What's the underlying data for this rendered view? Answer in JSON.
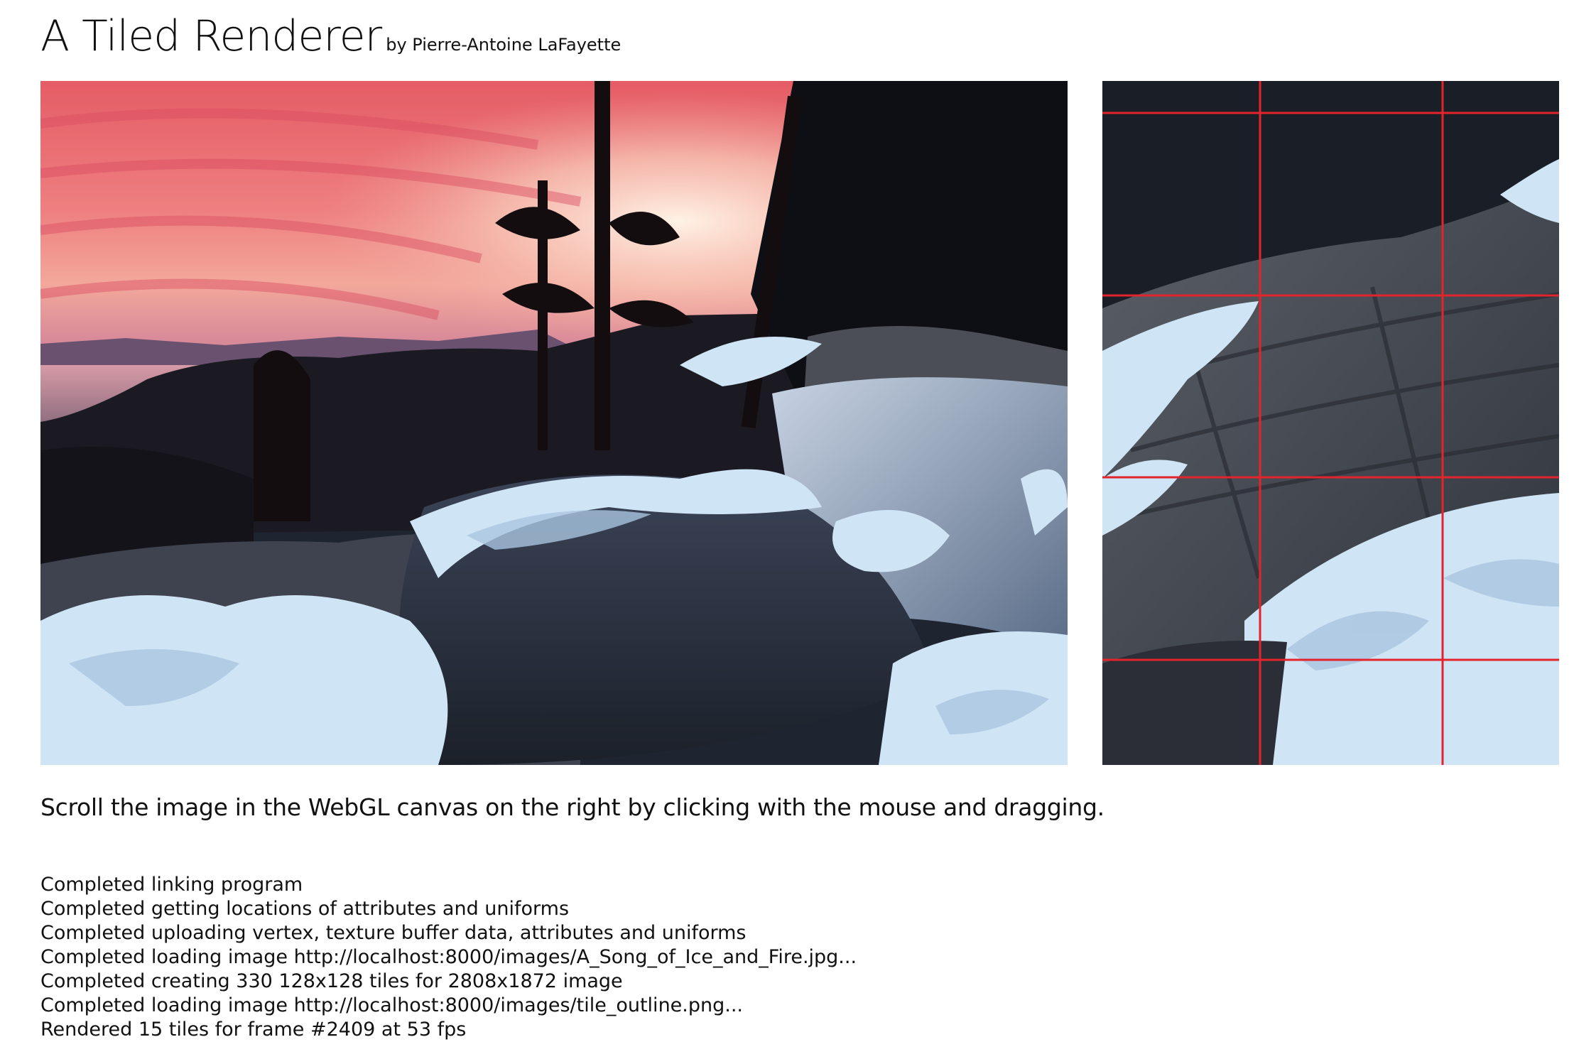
{
  "header": {
    "title": "A Tiled Renderer",
    "byline": "by Pierre-Antoine LaFayette"
  },
  "instructions": "Scroll the image in the WebGL canvas on the right by clicking with the mouse and dragging.",
  "log": [
    "Completed linking program",
    "Completed getting locations of attributes and uniforms",
    "Completed uploading vertex, texture buffer data, attributes and uniforms",
    "Completed loading image http://localhost:8000/images/A_Song_of_Ice_and_Fire.jpg...",
    "Completed creating 330 128x128 tiles for 2808x1872 image",
    "Completed loading image http://localhost:8000/images/tile_outline.png...",
    "Rendered 15 tiles for frame #2409 at 53 fps"
  ],
  "colors": {
    "tile_outline": "#e3242b",
    "sky_top": "#e96a6e",
    "sky_glow": "#f6b3a6",
    "water": "#2a3142",
    "snow": "#cfe4f4",
    "rock": "#4a4e58"
  }
}
